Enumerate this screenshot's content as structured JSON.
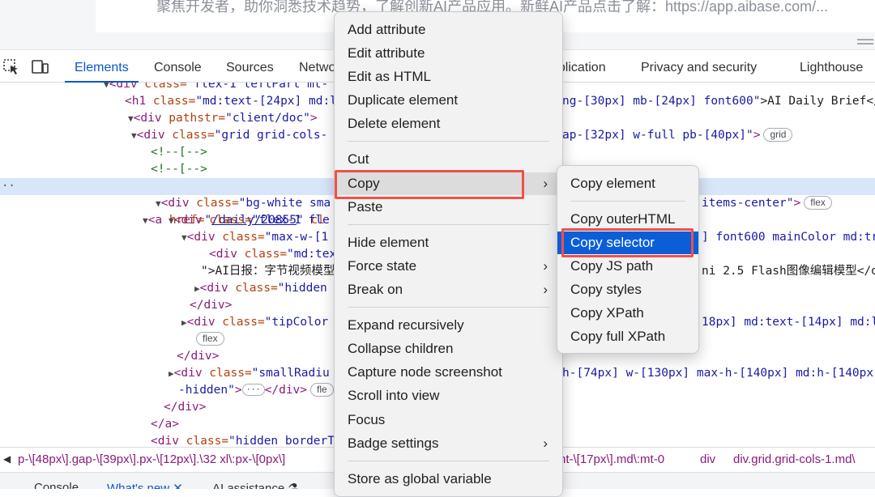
{
  "page": {
    "banner_text": "聚焦开发者，助你洞悉技术趋势，了解创新AI产品应用。新鲜AI产品点击了解：https://app.aibase.com/..."
  },
  "toolbar": {
    "tabs": [
      "Elements",
      "Console",
      "Sources",
      "Netwo",
      "pplication",
      "Privacy and security",
      "Lighthouse"
    ],
    "active_tab": "Elements"
  },
  "tree": {
    "r0": {
      "a": "div",
      "b": " class=",
      "c": "\"flex-1 leftPart mt-"
    },
    "r1": {
      "tag": "h1",
      "attr": " class=",
      "val": "\"md:text-[24px] md:l",
      "tail": "ng-[30px] mb-[24px] font600\"",
      "text": ">AI Daily Brief</"
    },
    "r2": {
      "tag": "div",
      "attr": " pathstr=",
      "val": "\"client/doc\"",
      "end": ">"
    },
    "r3": {
      "tag": "div",
      "attr": " class=",
      "val": "\"grid grid-cols-",
      "tail": "ap-[32px] w-full pb-[40px]\"",
      "end": ">",
      "badge": "grid"
    },
    "r4": {
      "comment": "<!--[-->"
    },
    "r5": {
      "comment": "<!--[-->"
    },
    "r6": {
      "tag": "a",
      "attr": " href=",
      "link": "/daily/20855",
      "rest": " cl"
    },
    "r7": {
      "tag": "div",
      "attr": " class=",
      "val": "\"bg-white sma",
      "tail": "items-center\"",
      "end": ">",
      "badge": "flex"
    },
    "r8": {
      "tag": "div",
      "attr": " class=",
      "val": "\"flex-1 fle"
    },
    "r9": {
      "tag": "div",
      "attr": " class=",
      "val": "\"max-w-[1",
      "tail": "] font600 mainColor md:tr"
    },
    "r10": {
      "tag": "div",
      "attr": " class=",
      "val": "\"md:tex"
    },
    "r11": {
      "text": "\">AI日报：字节视频模型",
      "tail": "ni 2.5 Flash图像编辑模型</di"
    },
    "r12": {
      "tag": "div",
      "attr": " class=",
      "val": "\"hidden"
    },
    "r13": {
      "close": "</div>"
    },
    "r14": {
      "tag": "div",
      "attr": " class=",
      "val": "\"tipColor",
      "tail": "18px] md:text-[14px] md:l"
    },
    "r15": {
      "badge": "flex"
    },
    "r16": {
      "close": "</div>"
    },
    "r17": {
      "tag": "div",
      "attr": " class=",
      "val": "\"smallRadiu",
      "tail": "h-[74px] w-[130px] max-h-[140px] md:h-[140px"
    },
    "r18": {
      "val": "-hidden\"",
      "end": ">",
      "dots": "···",
      "close": "</div>",
      "badge": "fle"
    },
    "r19": {
      "close": "</div>"
    },
    "r20": {
      "close": "</a>"
    },
    "r21": {
      "tag": "div",
      "attr": " class=",
      "val": "\"hidden borderT"
    }
  },
  "breadcrumb": {
    "left": "p-\\[48px\\].gap-\\[39px\\].px-\\[12px\\].\\32 xl\\:px-\\[0px\\]",
    "right_items": [
      "nt-\\[17px\\].md\\:mt-0",
      "div",
      "div.grid.grid-cols-1.md\\"
    ]
  },
  "drawer": {
    "tabs": [
      "Console",
      "What's new",
      "AI assistance"
    ]
  },
  "context_menu": {
    "items": [
      "Add attribute",
      "Edit attribute",
      "Edit as HTML",
      "Duplicate element",
      "Delete element",
      "Cut",
      "Copy",
      "Paste",
      "Hide element",
      "Force state",
      "Break on",
      "Expand recursively",
      "Collapse children",
      "Capture node screenshot",
      "Scroll into view",
      "Focus",
      "Badge settings",
      "Store as global variable"
    ]
  },
  "copy_submenu": {
    "items": [
      "Copy element",
      "Copy outerHTML",
      "Copy selector",
      "Copy JS path",
      "Copy styles",
      "Copy XPath",
      "Copy full XPath"
    ],
    "selected": "Copy selector"
  },
  "colors": {
    "accent": "#0b57d0",
    "highlight_outline": "#f0504a",
    "selected_item": "#0b5ed7"
  }
}
